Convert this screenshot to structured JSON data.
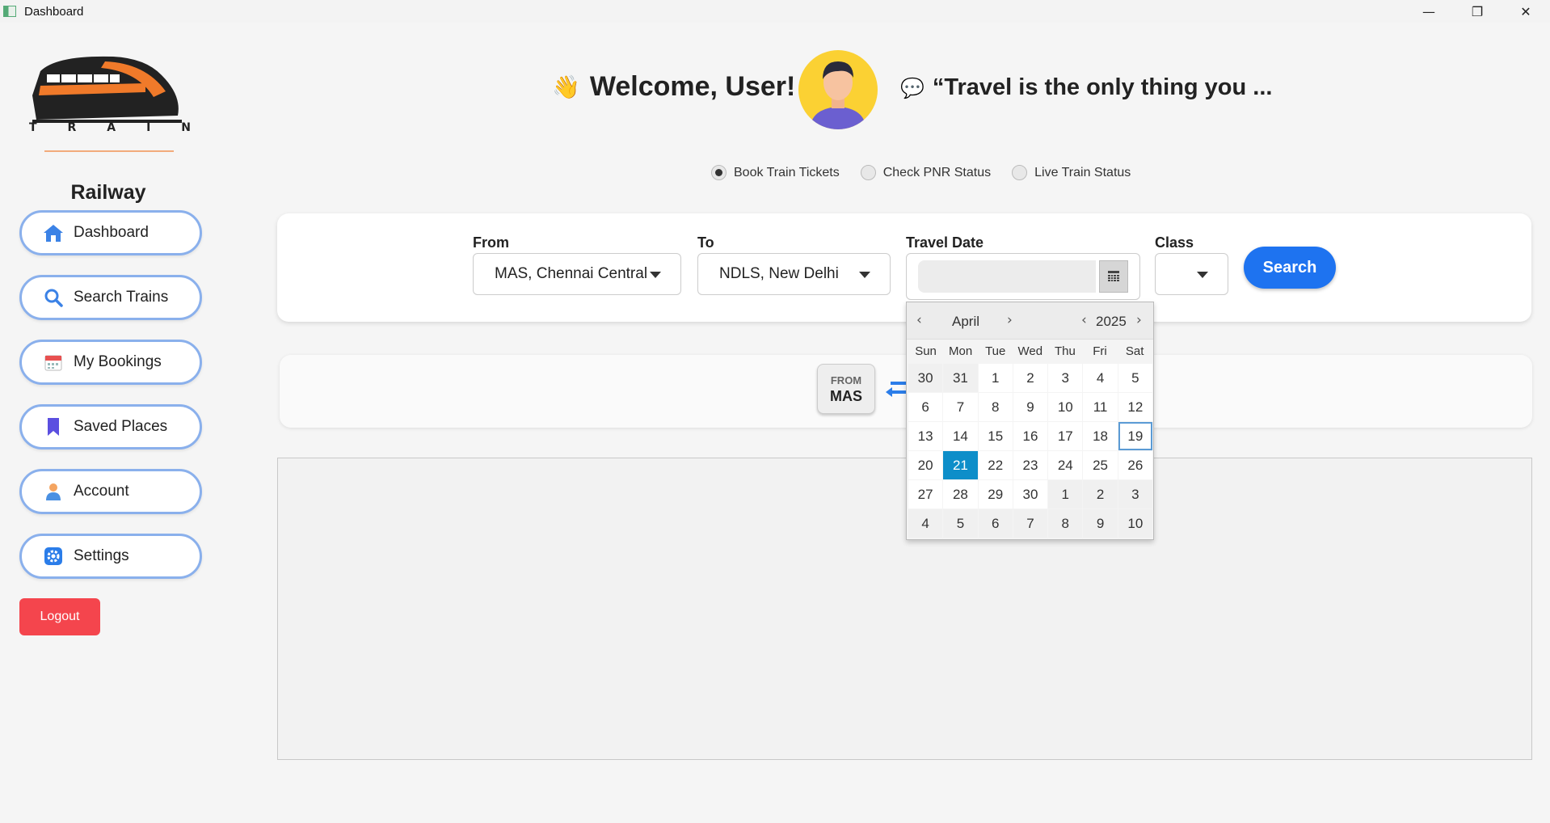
{
  "window": {
    "title": "Dashboard",
    "minimize": "—",
    "maximize": "❐",
    "close": "✕"
  },
  "sidebar": {
    "logo_letters": [
      "T",
      "R",
      "A",
      "I",
      "N"
    ],
    "brand": "Railway",
    "items": [
      {
        "label": "Dashboard",
        "icon": "home-icon"
      },
      {
        "label": "Search Trains",
        "icon": "search-icon"
      },
      {
        "label": "My Bookings",
        "icon": "calendar-icon"
      },
      {
        "label": "Saved Places",
        "icon": "bookmark-icon"
      },
      {
        "label": "Account",
        "icon": "user-icon"
      },
      {
        "label": "Settings",
        "icon": "gear-icon"
      }
    ],
    "logout": "Logout"
  },
  "header": {
    "wave": "👋",
    "welcome": "Welcome, User!",
    "bubble": "💬",
    "quote": "“Travel is the only thing you ..."
  },
  "modes": {
    "options": [
      "Book Train Tickets",
      "Check PNR Status",
      "Live Train Status"
    ],
    "selected": "Book Train Tickets"
  },
  "search": {
    "from_label": "From",
    "from_value": "MAS, Chennai Central",
    "to_label": "To",
    "to_value": "NDLS, New Delhi",
    "date_label": "Travel Date",
    "date_value": "",
    "class_label": "Class",
    "class_value": "",
    "button": "Search"
  },
  "route": {
    "from_small": "FROM",
    "from_code": "MAS"
  },
  "calendar": {
    "prev": "‹",
    "next": "›",
    "month": "April",
    "year": "2025",
    "weekdays": [
      "Sun",
      "Mon",
      "Tue",
      "Wed",
      "Thu",
      "Fri",
      "Sat"
    ],
    "days": [
      "30",
      "31",
      "1",
      "2",
      "3",
      "4",
      "5",
      "6",
      "7",
      "8",
      "9",
      "10",
      "11",
      "12",
      "13",
      "14",
      "15",
      "16",
      "17",
      "18",
      "19",
      "20",
      "21",
      "22",
      "23",
      "24",
      "25",
      "26",
      "27",
      "28",
      "29",
      "30",
      "1",
      "2",
      "3",
      "4",
      "5",
      "6",
      "7",
      "8",
      "9",
      "10"
    ],
    "today": "19",
    "selected": "21"
  },
  "colors": {
    "accent": "#1e73f0",
    "logout": "#f4454d",
    "nav_border": "#8ab0ec",
    "calendar_selected": "#0d8ec9",
    "calendar_today_border": "#5b9bd5",
    "avatar_bg": "#fbd133"
  }
}
